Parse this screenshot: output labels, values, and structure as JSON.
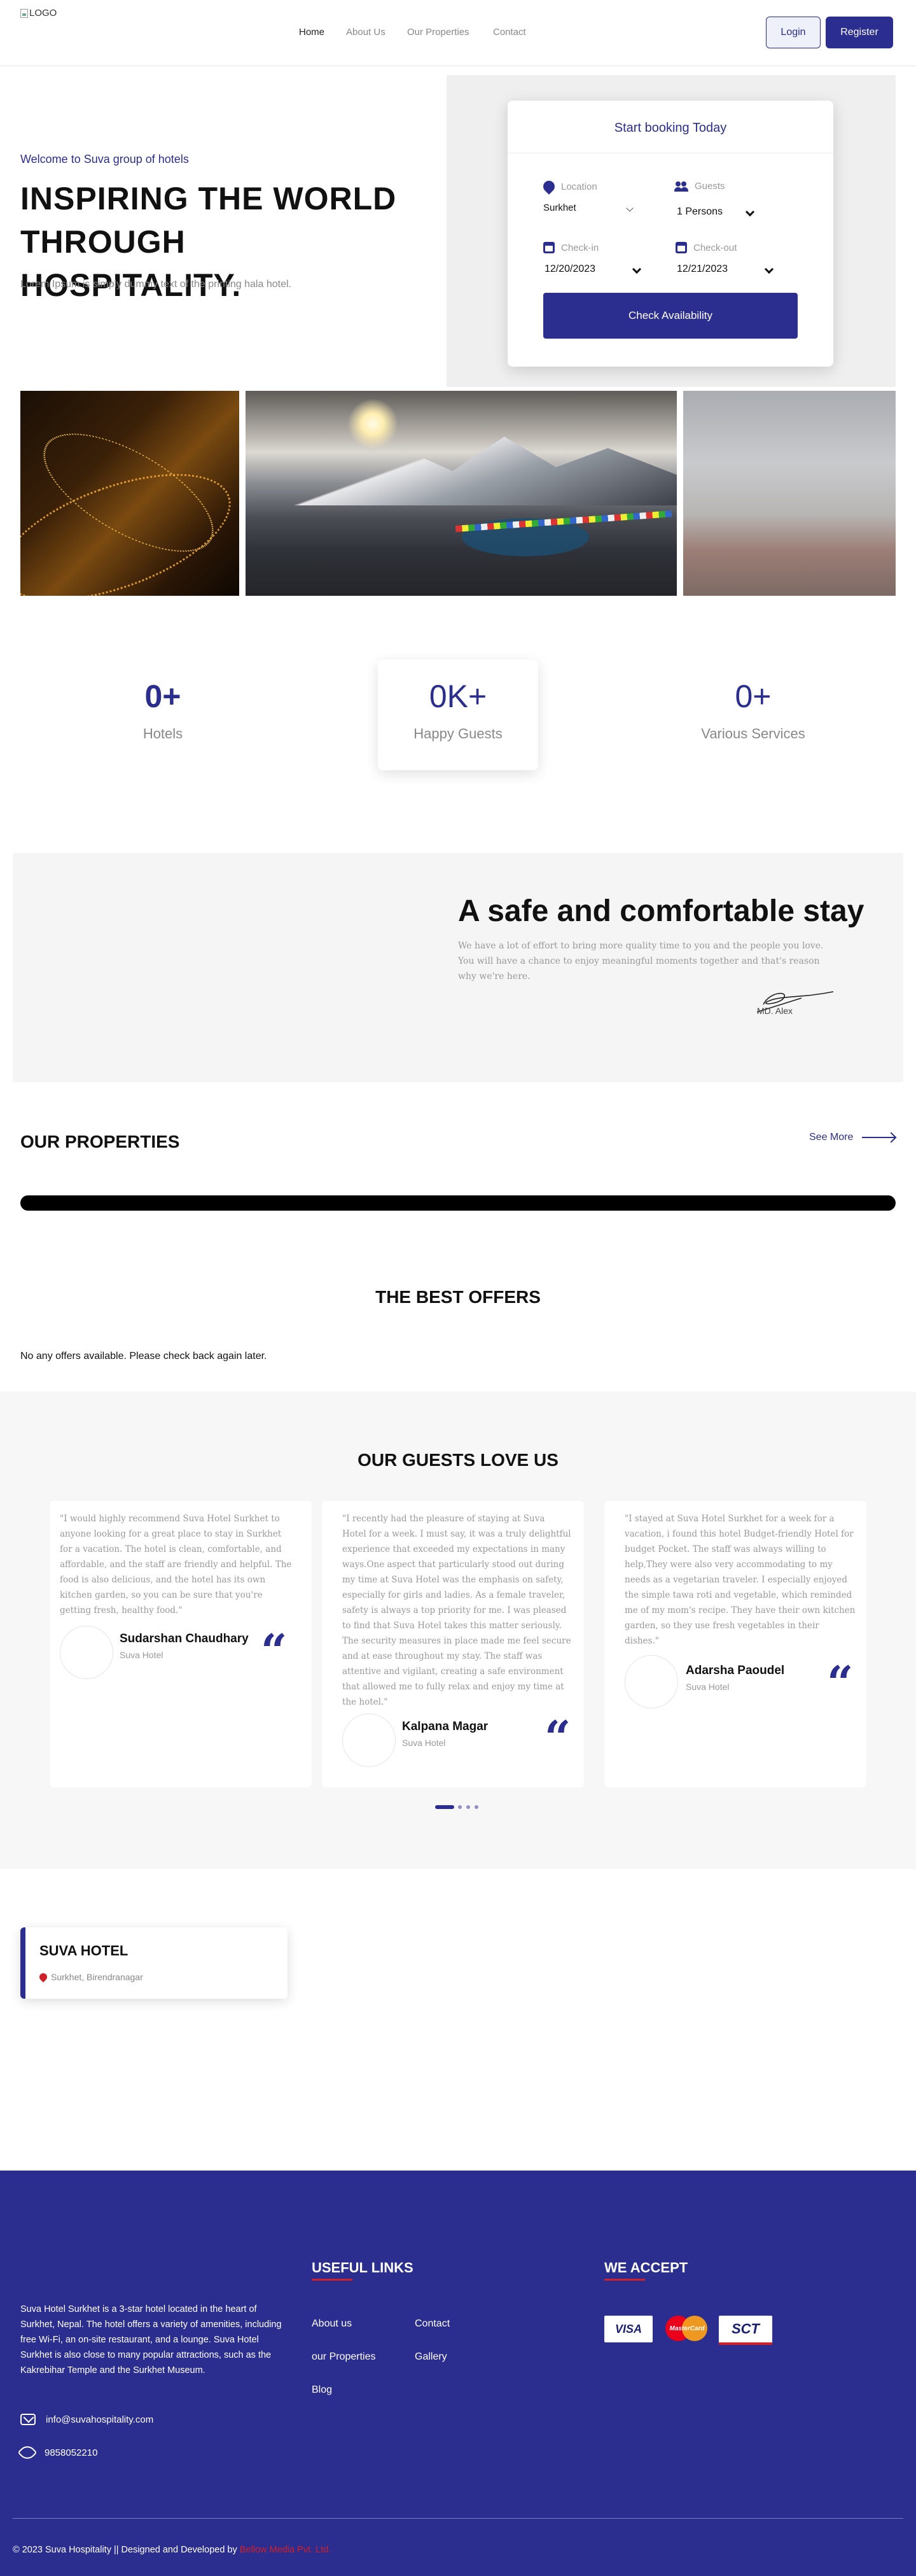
{
  "header": {
    "logo_alt": "LOGO",
    "nav": [
      "Home",
      "About Us",
      "Our Properties",
      "Contact"
    ],
    "login_label": "Login",
    "register_label": "Register"
  },
  "hero": {
    "welcome": "Welcome to Suva group of hotels",
    "headline": "INSPIRING THE WORLD THROUGH HOSPITALITY.",
    "subtext": "Lorem Ipsum is simply dummy text of the printing hala hotel."
  },
  "booking": {
    "title": "Start booking Today",
    "location_label": "Location",
    "location_value": "Surkhet",
    "guests_label": "Guests",
    "guests_value": "1 Persons",
    "checkin_label": "Check-in",
    "checkin_value": "12/20/2023",
    "checkout_label": "Check-out",
    "checkout_value": "12/21/2023",
    "button_label": "Check Availability"
  },
  "stats": [
    {
      "value": "0+",
      "label": "Hotels"
    },
    {
      "value": "0K+",
      "label": "Happy Guests"
    },
    {
      "value": "0+",
      "label": "Various Services"
    }
  ],
  "safe_stay": {
    "title": "A safe and comfortable stay",
    "text": "We have a lot of effort to bring more quality time to you and the people you love. You will have a chance to enjoy meaningful moments together and that's reason why we're here.",
    "signature_name": "MD. Alex"
  },
  "properties": {
    "title": "OUR PROPERTIES",
    "see_more": "See More"
  },
  "offers": {
    "title": "THE BEST OFFERS",
    "empty_text": "No any offers available. Please check back again later."
  },
  "guests": {
    "title": "OUR GUESTS LOVE US",
    "testimonials": [
      {
        "quote": "\"I would highly recommend Suva Hotel Surkhet to anyone looking for a great place to stay in Surkhet for a vacation. The hotel is clean, comfortable, and affordable, and the staff are friendly and helpful. The food is also delicious, and the hotel has its own kitchen garden, so you can be sure that you're getting fresh, healthy food.\"",
        "name": "Sudarshan Chaudhary",
        "hotel": "Suva Hotel"
      },
      {
        "quote": "\"I recently had the pleasure of staying at Suva Hotel for a week. I must say, it was a truly delightful experience that exceeded my expectations in many ways.One aspect that particularly stood out during my time at Suva Hotel was the emphasis on safety, especially for girls and ladies. As a female traveler, safety is always a top priority for me. I was pleased to find that Suva Hotel takes this matter seriously. The security measures in place made me feel secure and at ease throughout my stay. The staff was attentive and vigilant, creating a safe environment that allowed me to fully relax and enjoy my time at the hotel.\"",
        "name": "Kalpana Magar",
        "hotel": "Suva Hotel"
      },
      {
        "quote": "\"I stayed at Suva Hotel Surkhet for a week for a vacation, i found this hotel Budget-friendly Hotel for budget Pocket. The staff was always willing to help,They were also very accommodating to my needs as a vegetarian traveler. I especially enjoyed the simple tawa roti and vegetable, which reminded me of my mom's recipe. They have their own kitchen garden, so they use fresh vegetables in their dishes.\"",
        "name": "Adarsha Paoudel",
        "hotel": "Suva Hotel"
      }
    ]
  },
  "hotel_card": {
    "name": "SUVA HOTEL",
    "location": "Surkhet, Birendranagar"
  },
  "footer": {
    "about": "Suva Hotel Surkhet is a 3-star hotel located in the heart of Surkhet, Nepal. The hotel offers a variety of amenities, including free Wi-Fi, an on-site restaurant, and a lounge. Suva Hotel Surkhet is also close to many popular attractions, such as the Kakrebihar Temple and the Surkhet Museum.",
    "email": "info@suvahospitality.com",
    "phone": "9858052210",
    "useful_links_title": "USEFUL LINKS",
    "links": [
      "About us",
      "Contact",
      "our Properties",
      "Gallery",
      "Blog"
    ],
    "we_accept_title": "WE ACCEPT",
    "cards": [
      "VISA",
      "MasterCard",
      "SCT"
    ],
    "copyright": "© 2023 Suva Hospitality || Designed and Developed by",
    "developer": "Bellow Media Pvt. Ltd."
  },
  "colors": {
    "primary": "#2b2e8f",
    "accent_red": "#d0202a",
    "muted_text": "#888888",
    "section_bg": "#f7f7f7"
  }
}
